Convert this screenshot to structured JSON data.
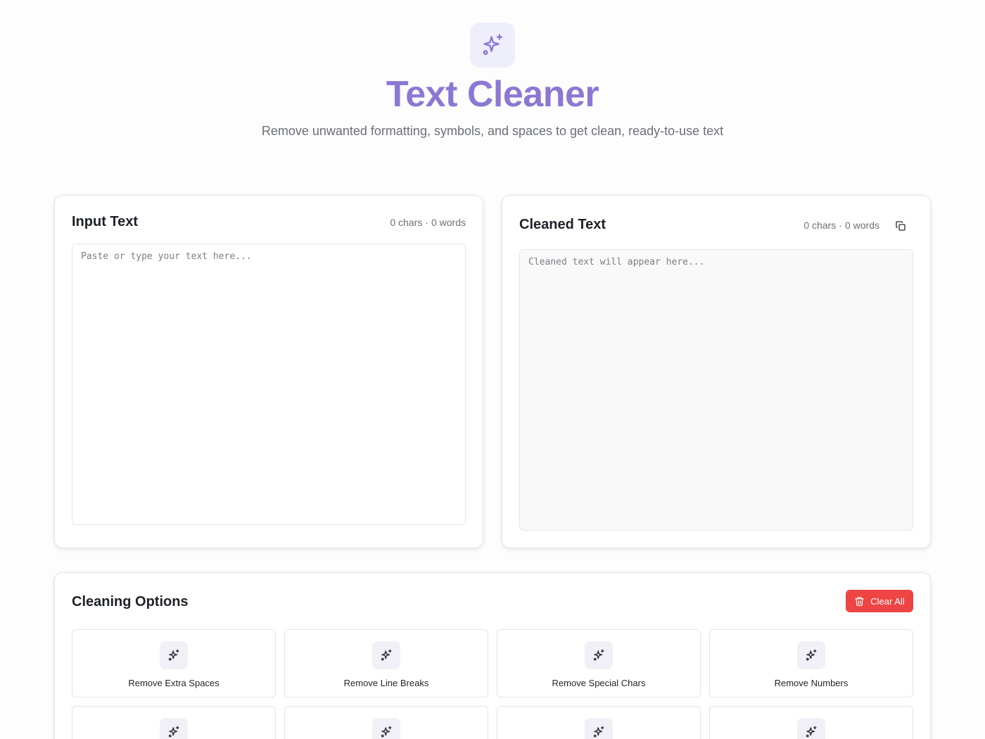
{
  "header": {
    "title": "Text Cleaner",
    "subtitle": "Remove unwanted formatting, symbols, and spaces to get clean, ready-to-use text",
    "icon": "sparkles-icon"
  },
  "colors": {
    "accent": "#8b78d4",
    "danger": "#ef4444"
  },
  "input_panel": {
    "title": "Input Text",
    "chars": "0 chars",
    "words": "0 words",
    "placeholder": "Paste or type your text here...",
    "value": ""
  },
  "output_panel": {
    "title": "Cleaned Text",
    "chars": "0 chars",
    "words": "0 words",
    "placeholder": "Cleaned text will appear here...",
    "value": "",
    "copy_icon": "copy-icon"
  },
  "options": {
    "title": "Cleaning Options",
    "clear_label": "Clear All",
    "items": [
      {
        "label": "Remove Extra Spaces"
      },
      {
        "label": "Remove Line Breaks"
      },
      {
        "label": "Remove Special Chars"
      },
      {
        "label": "Remove Numbers"
      },
      {
        "label": ""
      },
      {
        "label": ""
      },
      {
        "label": ""
      },
      {
        "label": ""
      }
    ]
  }
}
